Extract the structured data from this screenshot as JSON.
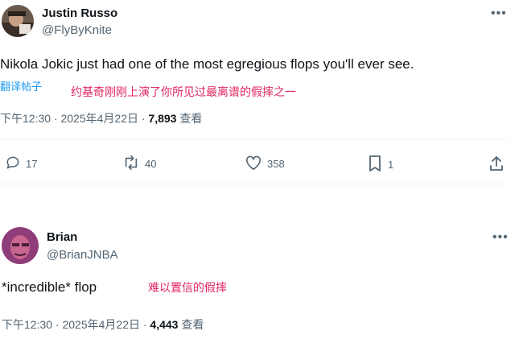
{
  "tweet1": {
    "name": "Justin Russo",
    "handle": "@FlyByKnite",
    "text": "Nikola Jokic just had one of the most egregious flops you'll ever see.",
    "translate_label": "翻译帖子",
    "annotation": "约基奇刚刚上演了你所见过最离谱的假摔之一",
    "time": "下午12:30 · 2025年4月22日 ·",
    "views": "7,893",
    "views_label": "查看",
    "actions": {
      "replies": "17",
      "reposts": "40",
      "likes": "358",
      "bookmarks": "1"
    },
    "icons": [
      "more-icon",
      "reply-icon",
      "repost-icon",
      "like-icon",
      "bookmark-icon",
      "share-icon"
    ]
  },
  "tweet2": {
    "name": "Brian",
    "handle": "@BrianJNBA",
    "text": "*incredible* flop",
    "annotation": "难以置信的假摔",
    "time": "下午12:30 · 2025年4月22日 ·",
    "views": "4,443",
    "views_label": "查看"
  },
  "colors": {
    "text_primary": "#0f1419",
    "text_secondary": "#536471",
    "link_blue": "#1d9bf0",
    "annotation_red": "#e0245e"
  }
}
